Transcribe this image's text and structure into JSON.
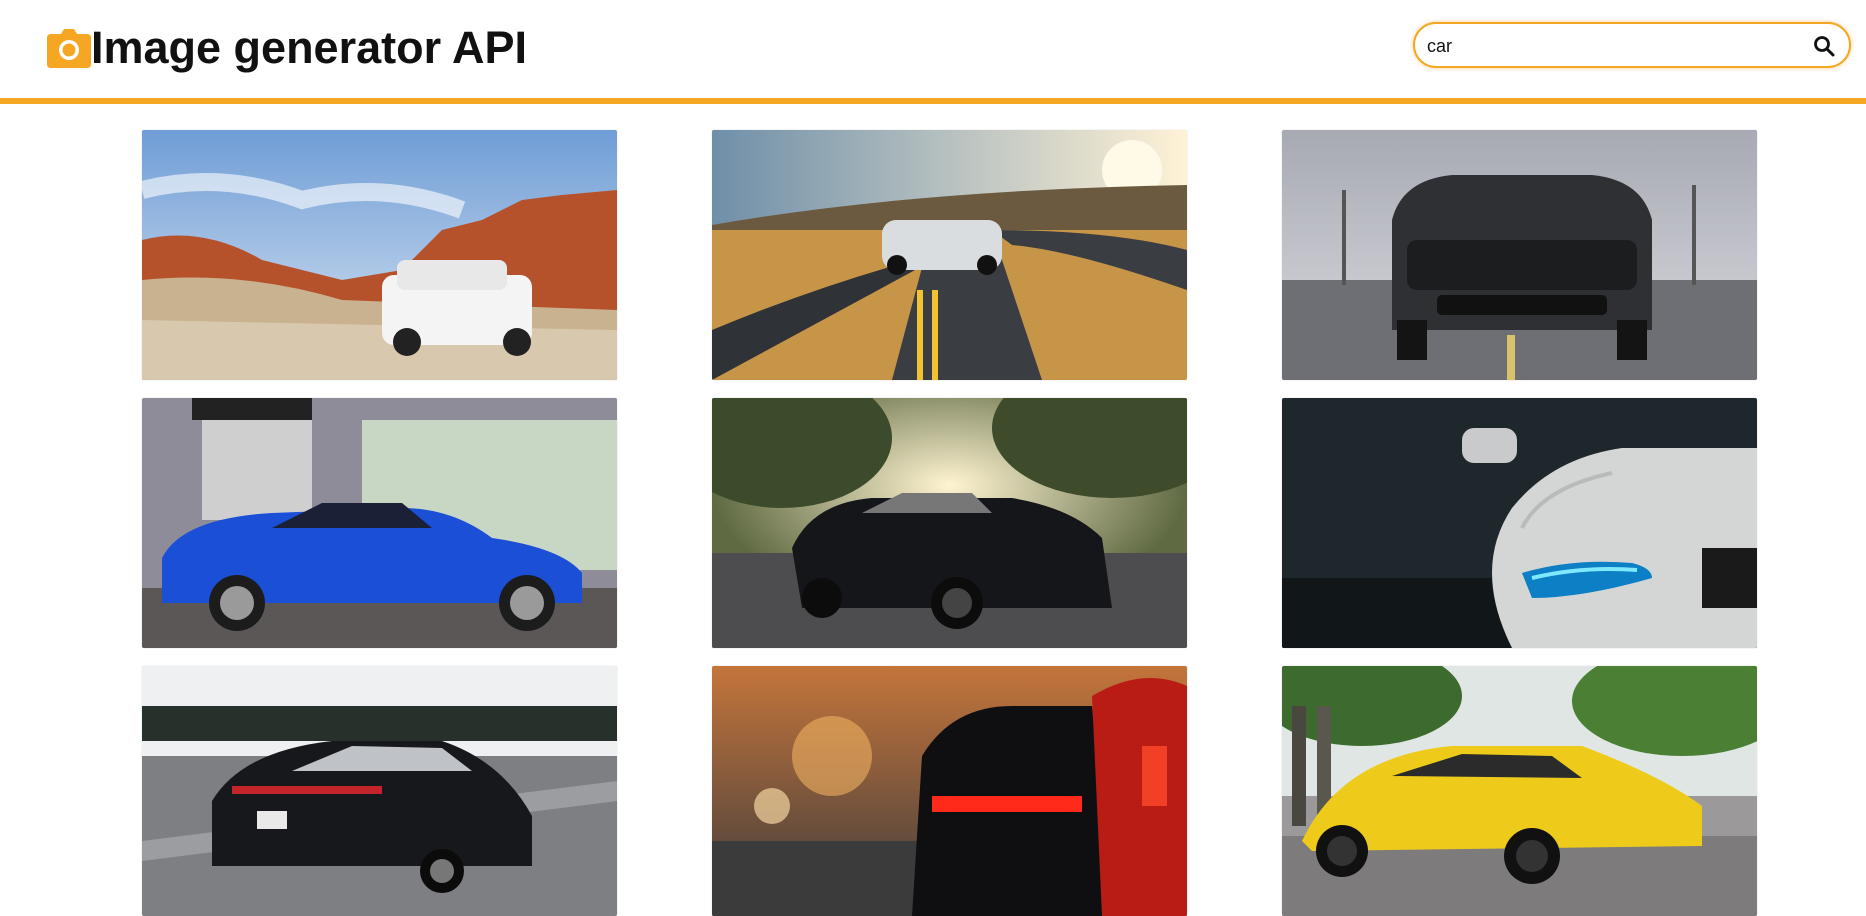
{
  "header": {
    "title": "Image generator API",
    "logo_icon": "camera-icon",
    "accent_color": "#f5a623"
  },
  "search": {
    "value": "car",
    "placeholder": "",
    "button_icon": "search-icon"
  },
  "gallery": {
    "images": [
      {
        "subject": "white SUV in desert canyon"
      },
      {
        "subject": "white sports car on winding road at sunset"
      },
      {
        "subject": "black muscle car front view"
      },
      {
        "subject": "blue coupe in front of entrance"
      },
      {
        "subject": "black muscle car under trees at sunset"
      },
      {
        "subject": "white car headlight close-up"
      },
      {
        "subject": "black sedan on highway"
      },
      {
        "subject": "black sports car rear lights in city"
      },
      {
        "subject": "yellow supercar on street"
      }
    ]
  }
}
